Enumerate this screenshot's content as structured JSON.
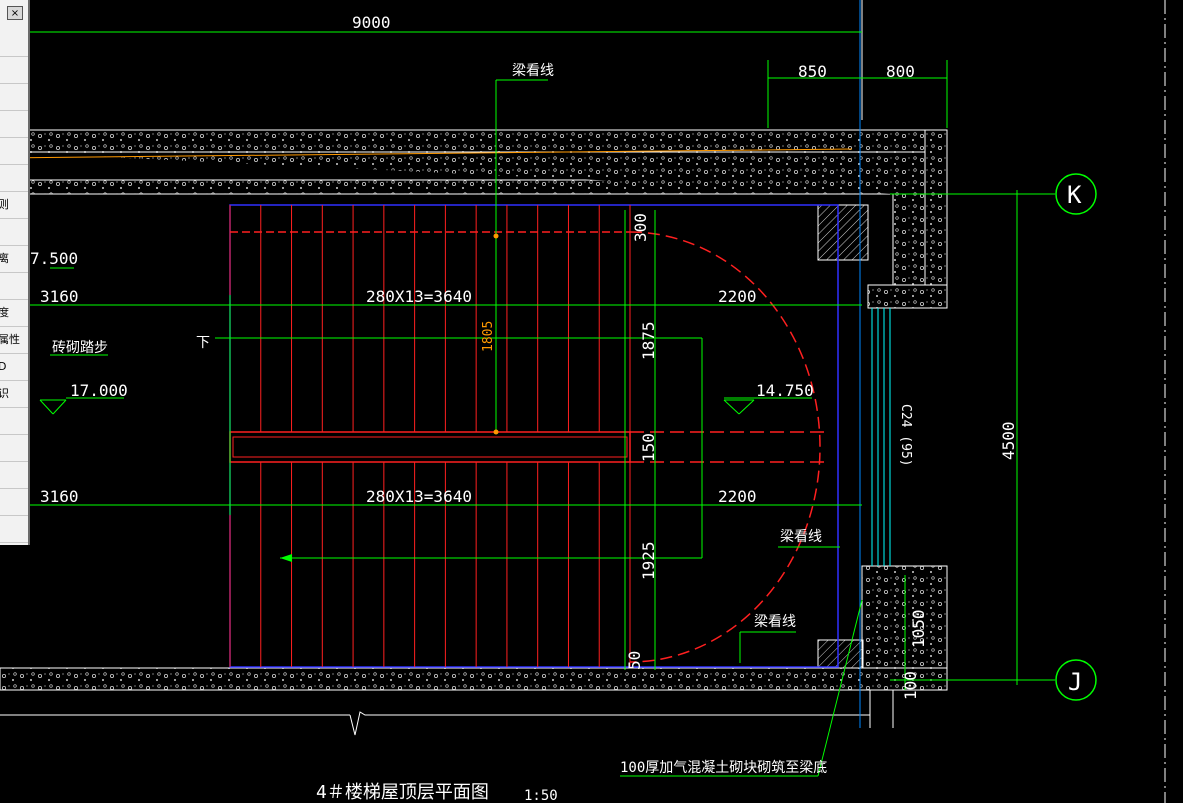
{
  "drawing": {
    "title": "4＃楼梯屋顶层平面图",
    "scale": "1:50",
    "dimensions": {
      "overall": "9000",
      "top_right_a": "850",
      "top_right_b": "800",
      "left_upper": "3160",
      "left_lower": "3160",
      "run_upper": "280X13=3640",
      "run_lower": "280X13=3640",
      "landing_upper": "2200",
      "landing_lower": "2200",
      "v_300": "300",
      "v_1875": "1875",
      "v_1805": "1805",
      "v_150": "150",
      "v_1925": "1925",
      "v_50": "50",
      "v_4500": "4500",
      "v_1050": "1050",
      "v_100": "100"
    },
    "annotations": {
      "beam_line_top": "梁看线",
      "beam_line_mid": "梁看线",
      "beam_line_bottom": "梁看线",
      "brick_steps": "砖砌踏步",
      "down": "下",
      "window": "C24 (95)",
      "wall_note": "100厚加气混凝土砌块砌筑至梁底"
    },
    "elevations": {
      "left_top": "7.500",
      "left": "17.000",
      "landing": "14.750"
    },
    "grid_axes": [
      "K",
      "J"
    ]
  },
  "palette": {
    "close_label": "×",
    "items": [
      "",
      "",
      "",
      "",
      "",
      "",
      "则",
      "",
      "离",
      "",
      "度",
      "属性",
      "D",
      "识",
      "",
      "",
      "",
      "",
      ""
    ]
  },
  "colors": {
    "background": "#000000",
    "dimension": "#00ff00",
    "stair": "#ff2020",
    "text": "#ffffff",
    "wall_outline": "#ffffff",
    "window": "#00ffff",
    "beam_line": "#0000ff",
    "accent_orange": "#ff9900"
  }
}
